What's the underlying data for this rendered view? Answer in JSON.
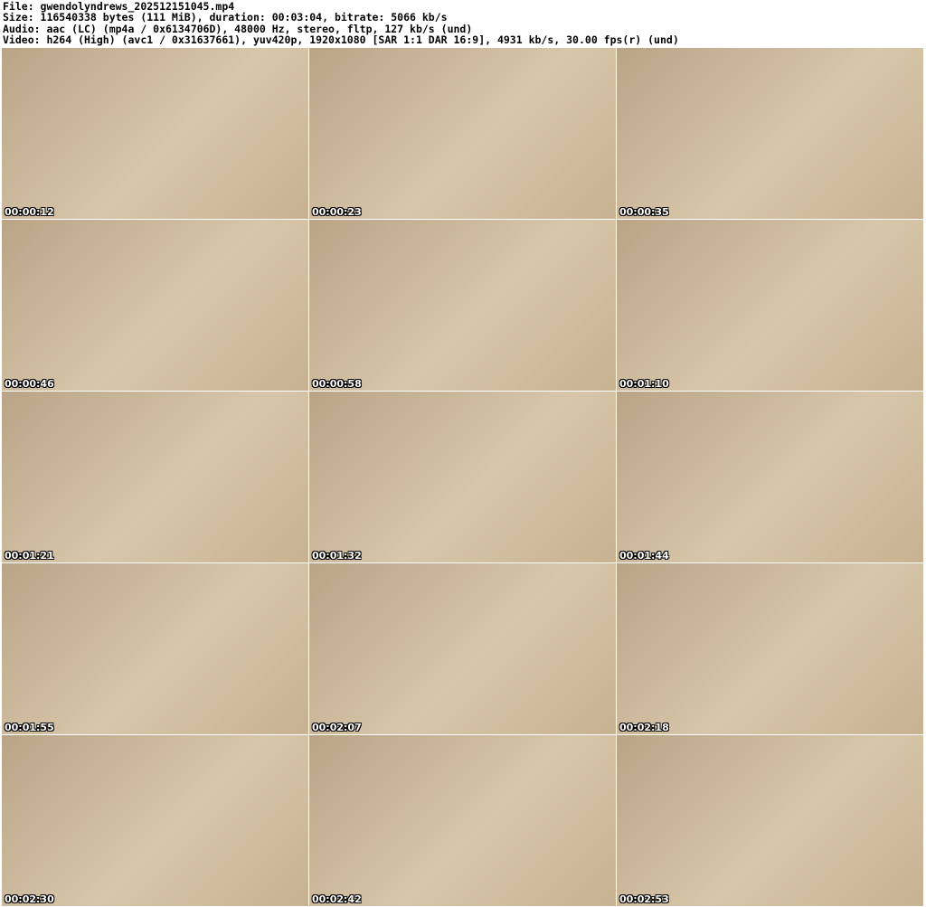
{
  "header": {
    "file": "File: gwendolyndrews_202512151045.mp4",
    "size": "Size: 116540338 bytes (111 MiB), duration: 00:03:04, bitrate: 5066 kb/s",
    "audio": "Audio: aac (LC) (mp4a / 0x6134706D), 48000 Hz, stereo, fltp, 127 kb/s (und)",
    "video": "Video: h264 (High) (avc1 / 0x31637661), yuv420p, 1920x1080 [SAR 1:1 DAR 16:9], 4931 kb/s, 30.00 fps(r) (und)"
  },
  "frames": [
    "00:00:12",
    "00:00:23",
    "00:00:35",
    "00:00:46",
    "00:00:58",
    "00:01:10",
    "00:01:21",
    "00:01:32",
    "00:01:44",
    "00:01:55",
    "00:02:07",
    "00:02:18",
    "00:02:30",
    "00:02:42",
    "00:02:53"
  ]
}
